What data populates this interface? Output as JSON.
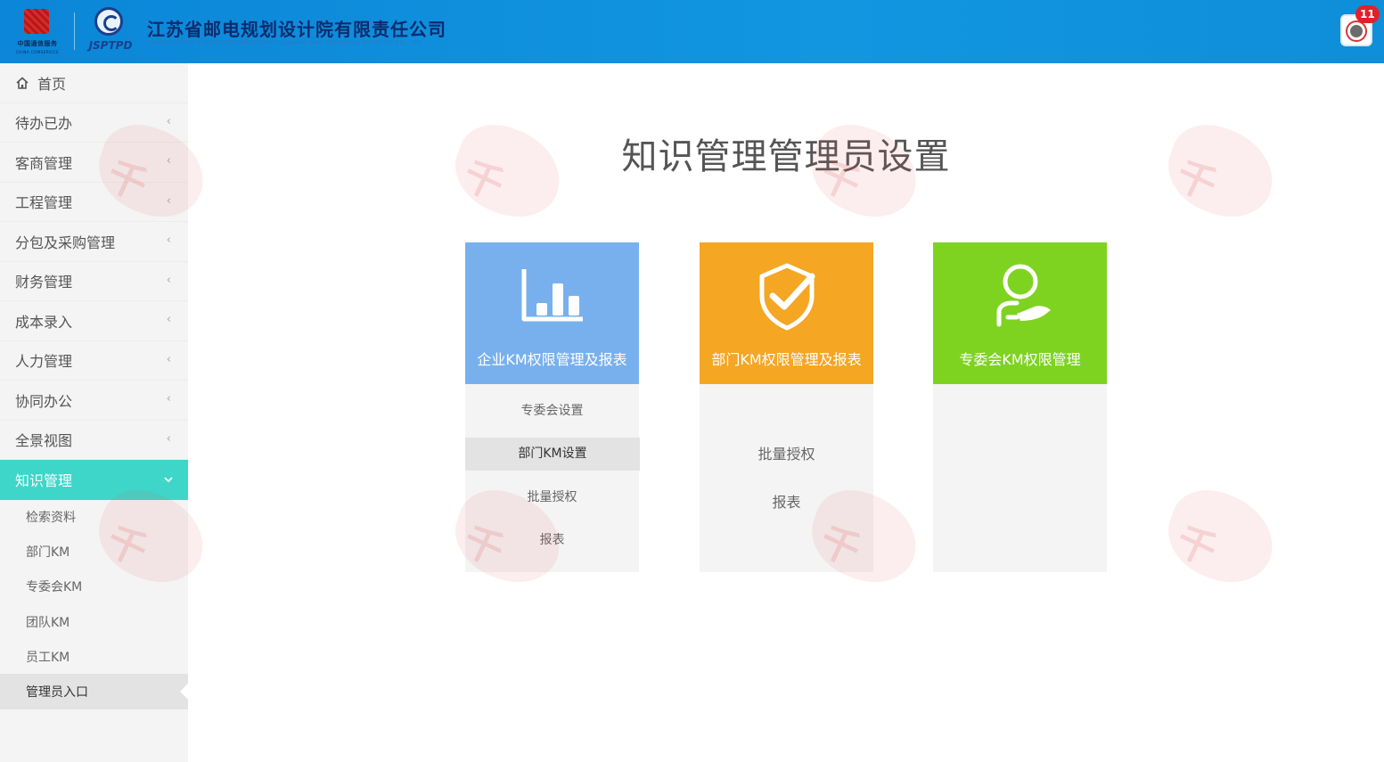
{
  "header": {
    "company_name": "江苏省邮电规划设计院有限责任公司",
    "logo_left_caption": "中国通信服务",
    "logo_left_subcaption": "CHINA COMSERVICE",
    "logo_right_caption": "JSPTPD",
    "notification_count": "11",
    "colors": {
      "bar": "#0b86d8",
      "badge": "#e0212a"
    }
  },
  "sidebar": {
    "home_label": "首页",
    "items": [
      {
        "label": "待办已办"
      },
      {
        "label": "客商管理"
      },
      {
        "label": "工程管理"
      },
      {
        "label": "分包及采购管理"
      },
      {
        "label": "财务管理"
      },
      {
        "label": "成本录入"
      },
      {
        "label": "人力管理"
      },
      {
        "label": "协同办公"
      },
      {
        "label": "全景视图"
      }
    ],
    "active_item": {
      "label": "知识管理"
    },
    "sub_items": [
      {
        "label": "检索资料"
      },
      {
        "label": "部门KM"
      },
      {
        "label": "专委会KM"
      },
      {
        "label": "团队KM"
      },
      {
        "label": "员工KM"
      },
      {
        "label": "管理员入口"
      }
    ],
    "active_color": "#3ed6c8"
  },
  "main": {
    "title": "知识管理管理员设置",
    "cards": [
      {
        "title": "企业KM权限管理及报表",
        "icon": "bar-chart-icon",
        "color": "#78b0ee",
        "links": [
          "专委会设置",
          "部门KM设置",
          "批量授权",
          "报表"
        ]
      },
      {
        "title": "部门KM权限管理及报表",
        "icon": "shield-check-icon",
        "color": "#f5a623",
        "links": [
          "批量授权",
          "报表"
        ]
      },
      {
        "title": "专委会KM权限管理",
        "icon": "user-hand-icon",
        "color": "#7ed321",
        "links": []
      }
    ]
  }
}
